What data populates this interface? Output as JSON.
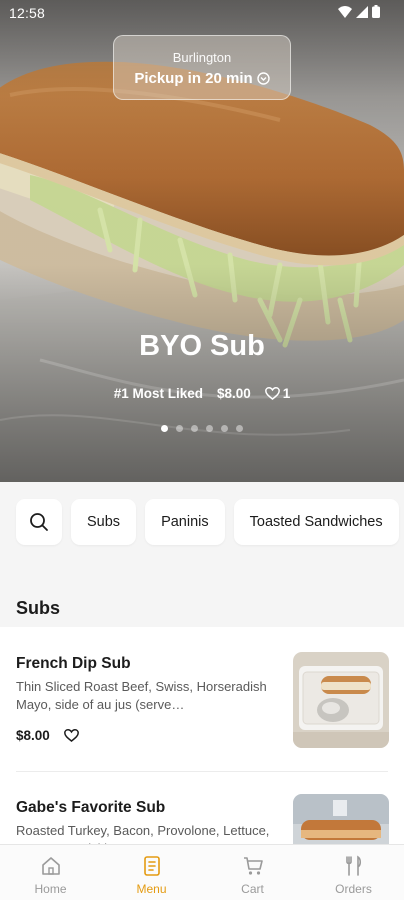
{
  "status_bar": {
    "time": "12:58",
    "icons": [
      "wifi-icon",
      "cell-signal-icon",
      "battery-icon"
    ]
  },
  "pickup": {
    "location": "Burlington",
    "label": "Pickup in 20 min",
    "icon": "chevron-down-icon"
  },
  "featured": {
    "title": "BYO Sub",
    "rank": "#1 Most Liked",
    "price": "$8.00",
    "likes": "1",
    "carousel": {
      "count": 6,
      "active": 1
    }
  },
  "categories": {
    "search_icon": "search-icon",
    "chips": [
      "Subs",
      "Paninis",
      "Toasted Sandwiches"
    ]
  },
  "section": {
    "title": "Subs"
  },
  "items": [
    {
      "name": "French Dip Sub",
      "description": "Thin Sliced Roast Beef, Swiss, Horseradish Mayo, side of au jus (serve…",
      "price": "$8.00"
    },
    {
      "name": "Gabe's Favorite Sub",
      "description": "Roasted Turkey, Bacon, Provolone, Lettuce, Tomatoes, Pickles, Mayo",
      "price": ""
    }
  ],
  "nav": [
    {
      "label": "Home",
      "icon": "home-icon",
      "active": false
    },
    {
      "label": "Menu",
      "icon": "menu-icon",
      "active": true
    },
    {
      "label": "Cart",
      "icon": "cart-icon",
      "active": false
    },
    {
      "label": "Orders",
      "icon": "orders-icon",
      "active": false
    }
  ],
  "colors": {
    "accent": "#e49b12",
    "page_background": "#f5f5f5"
  }
}
